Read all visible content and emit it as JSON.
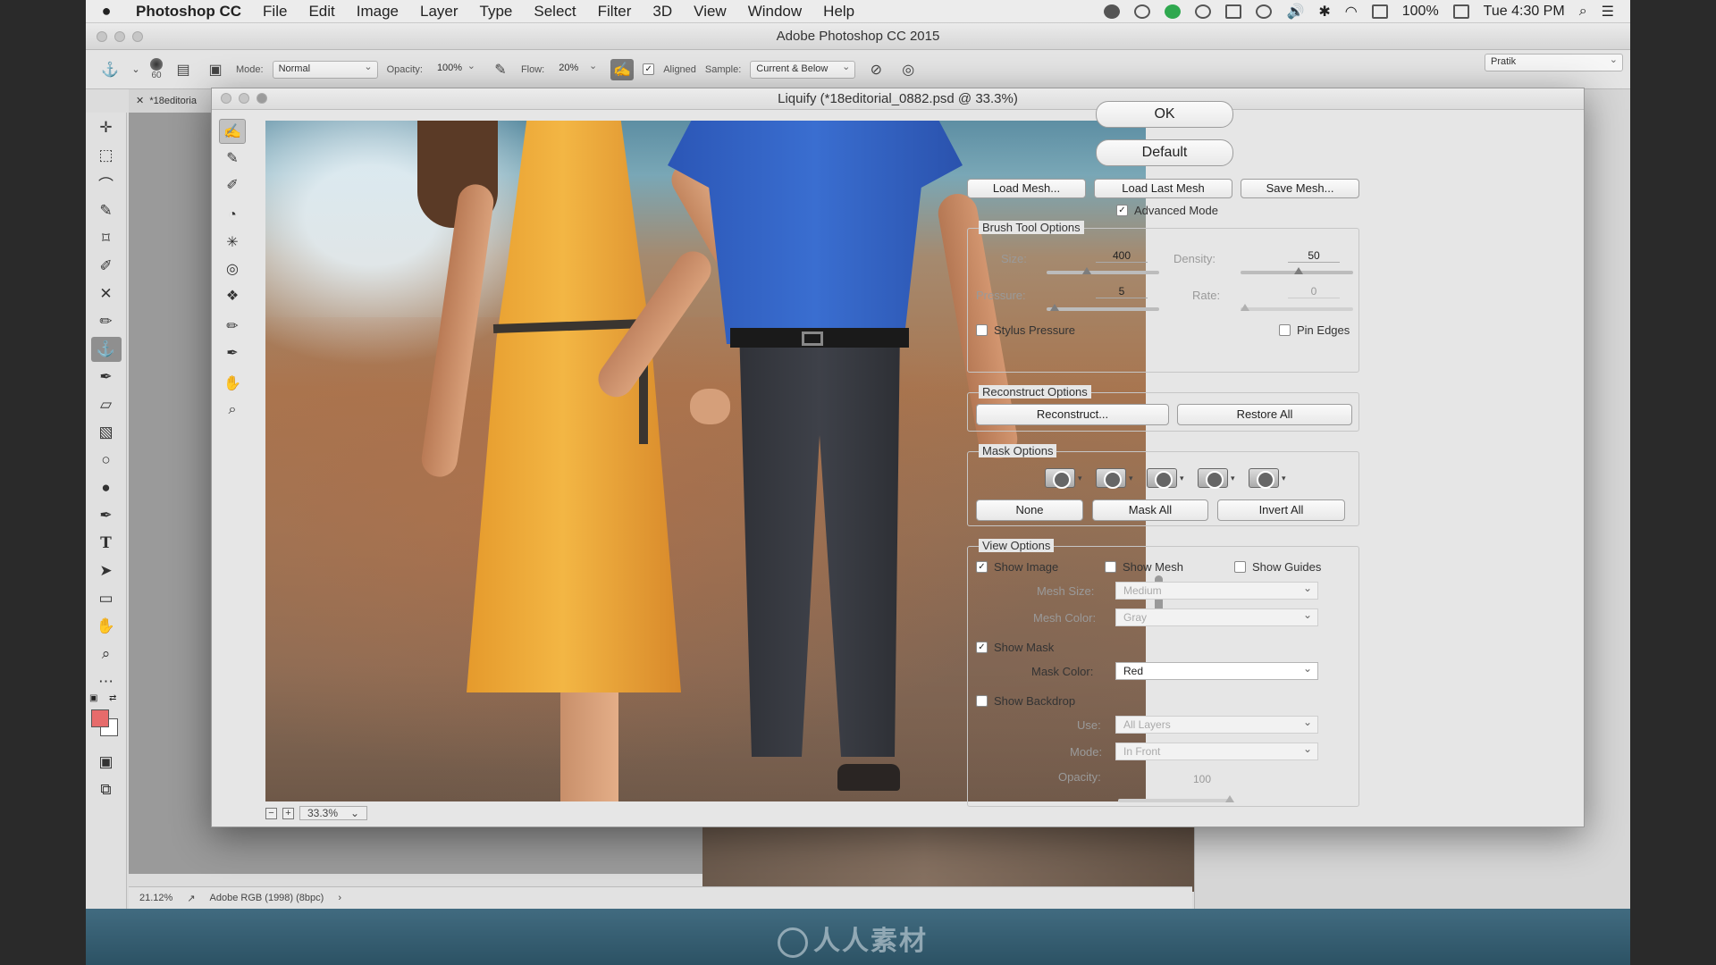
{
  "menubar": {
    "app": "Photoshop CC",
    "items": [
      "File",
      "Edit",
      "Image",
      "Layer",
      "Type",
      "Select",
      "Filter",
      "3D",
      "View",
      "Window",
      "Help"
    ],
    "battery": "100%",
    "clock": "Tue 4:30 PM"
  },
  "window": {
    "title": "Adobe Photoshop CC 2015"
  },
  "options": {
    "brush_size": "60",
    "mode_label": "Mode:",
    "mode_value": "Normal",
    "opacity_label": "Opacity:",
    "opacity_value": "100%",
    "flow_label": "Flow:",
    "flow_value": "20%",
    "aligned_label": "Aligned",
    "sample_label": "Sample:",
    "sample_value": "Current & Below",
    "workspace": "Pratik"
  },
  "document": {
    "tab": "*18editoria",
    "zoom": "21.12%",
    "profile": "Adobe RGB (1998) (8bpc)"
  },
  "liquify": {
    "title": "Liquify (*18editorial_0882.psd @ 33.3%)",
    "preview_zoom": "33.3%",
    "ok": "OK",
    "default": "Default",
    "load_mesh": "Load Mesh...",
    "load_last_mesh": "Load Last Mesh",
    "save_mesh": "Save Mesh...",
    "advanced_mode": "Advanced Mode",
    "brush": {
      "legend": "Brush Tool Options",
      "size_label": "Size:",
      "size": "400",
      "density_label": "Density:",
      "density": "50",
      "pressure_label": "Pressure:",
      "pressure": "5",
      "rate_label": "Rate:",
      "rate": "0",
      "stylus": "Stylus Pressure",
      "pin_edges": "Pin Edges"
    },
    "reconstruct": {
      "legend": "Reconstruct Options",
      "reconstruct": "Reconstruct...",
      "restore_all": "Restore All"
    },
    "mask": {
      "legend": "Mask Options",
      "none": "None",
      "mask_all": "Mask All",
      "invert_all": "Invert All"
    },
    "view": {
      "legend": "View Options",
      "show_image": "Show Image",
      "show_mesh": "Show Mesh",
      "show_guides": "Show Guides",
      "mesh_size_label": "Mesh Size:",
      "mesh_size": "Medium",
      "mesh_color_label": "Mesh Color:",
      "mesh_color": "Gray",
      "show_mask": "Show Mask",
      "mask_color_label": "Mask Color:",
      "mask_color": "Red",
      "show_backdrop": "Show Backdrop",
      "use_label": "Use:",
      "use": "All Layers",
      "mode_label": "Mode:",
      "mode": "In Front",
      "opacity_label": "Opacity:",
      "opacity": "100"
    }
  },
  "watermark": "人人素材",
  "colors": {
    "foreground": "#e66b6b",
    "background": "#ffffff"
  }
}
